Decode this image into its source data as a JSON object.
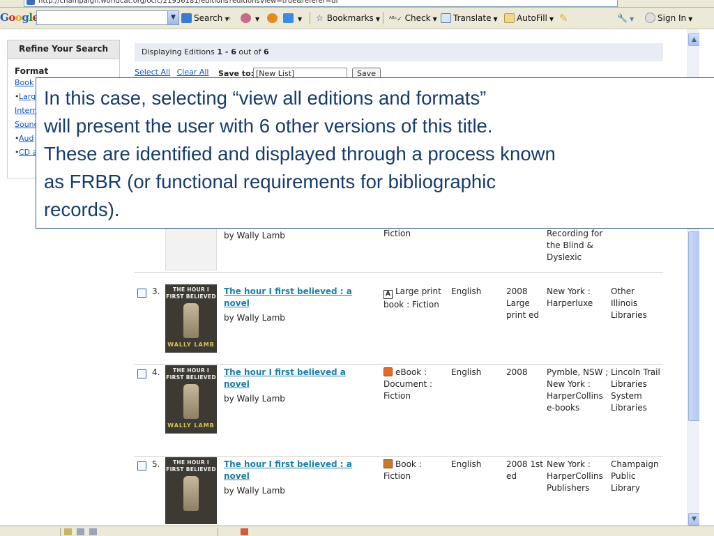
{
  "browser": {
    "address": "http://champaign.worldcat.org/oclc/21956181/editions?editionsView=true&referer=di",
    "google_logo": [
      "G",
      "o",
      "o",
      "g",
      "l",
      "e"
    ],
    "toolbar": {
      "search": "Search",
      "bookmarks": "Bookmarks",
      "check": "Check",
      "translate": "Translate",
      "autofill": "AutoFill",
      "sign_in": "Sign In"
    }
  },
  "sidebar": {
    "title": "Refine Your Search",
    "format_heading": "Format",
    "links": [
      "Book",
      "Larg",
      "Intern",
      "Sound",
      "Aud",
      "CD a"
    ]
  },
  "results": {
    "displaying": "Displaying Editions",
    "range": "1 - 6",
    "total_text": "out of",
    "total": "6",
    "select_all": "Select All",
    "clear_all": "Clear All",
    "save_to": "Save to:",
    "list_value": "[New List]",
    "save_button": "Save",
    "partial_row": {
      "author": "by Wally Lamb",
      "format": "Fiction",
      "publisher": "",
      "held": "Recording for the Blind & Dyslexic"
    },
    "rows": [
      {
        "num": "3.",
        "cover_title": "THE HOUR I FIRST BELIEVED",
        "cover_author": "WALLY LAMB",
        "title": "The hour I first believed : a novel",
        "author": "by Wally Lamb",
        "format_icon": "large-print-icon",
        "format": "Large print book : Fiction",
        "language": "English",
        "year": "2008 Large print ed",
        "publisher": "New York : Harperluxe",
        "held": "Other Illinois Libraries"
      },
      {
        "num": "4.",
        "cover_title": "THE HOUR I FIRST BELIEVED",
        "cover_author": "WALLY LAMB",
        "title": "The hour I first believed a novel",
        "author": "by Wally Lamb",
        "format_icon": "ebook-icon",
        "format": "eBook : Document : Fiction",
        "language": "English",
        "year": "2008",
        "publisher": "Pymble, NSW ; New York : HarperCollins e-books",
        "held": "Lincoln Trail Libraries System Libraries"
      },
      {
        "num": "5.",
        "cover_title": "THE HOUR I FIRST BELIEVED",
        "cover_author": "",
        "title": "The hour I first believed : a novel",
        "author": "by Wally Lamb",
        "format_icon": "book-icon",
        "format": "Book : Fiction",
        "language": "English",
        "year": "2008 1st ed",
        "publisher": "New York : HarperCollins Publishers",
        "held": "Champaign Public Library"
      }
    ]
  },
  "callout": {
    "lines": [
      "In this case, selecting “view all editions and formats”",
      "will present the user with 6 other versions of this title.",
      "These are identified and displayed through a process known",
      "as FRBR (or functional requirements for bibliographic",
      "records)."
    ]
  },
  "colors": {
    "link": "#1155cc",
    "title_link": "#1a7fa8",
    "callout_text": "#173b6e",
    "header_bg": "#e8edf5"
  }
}
